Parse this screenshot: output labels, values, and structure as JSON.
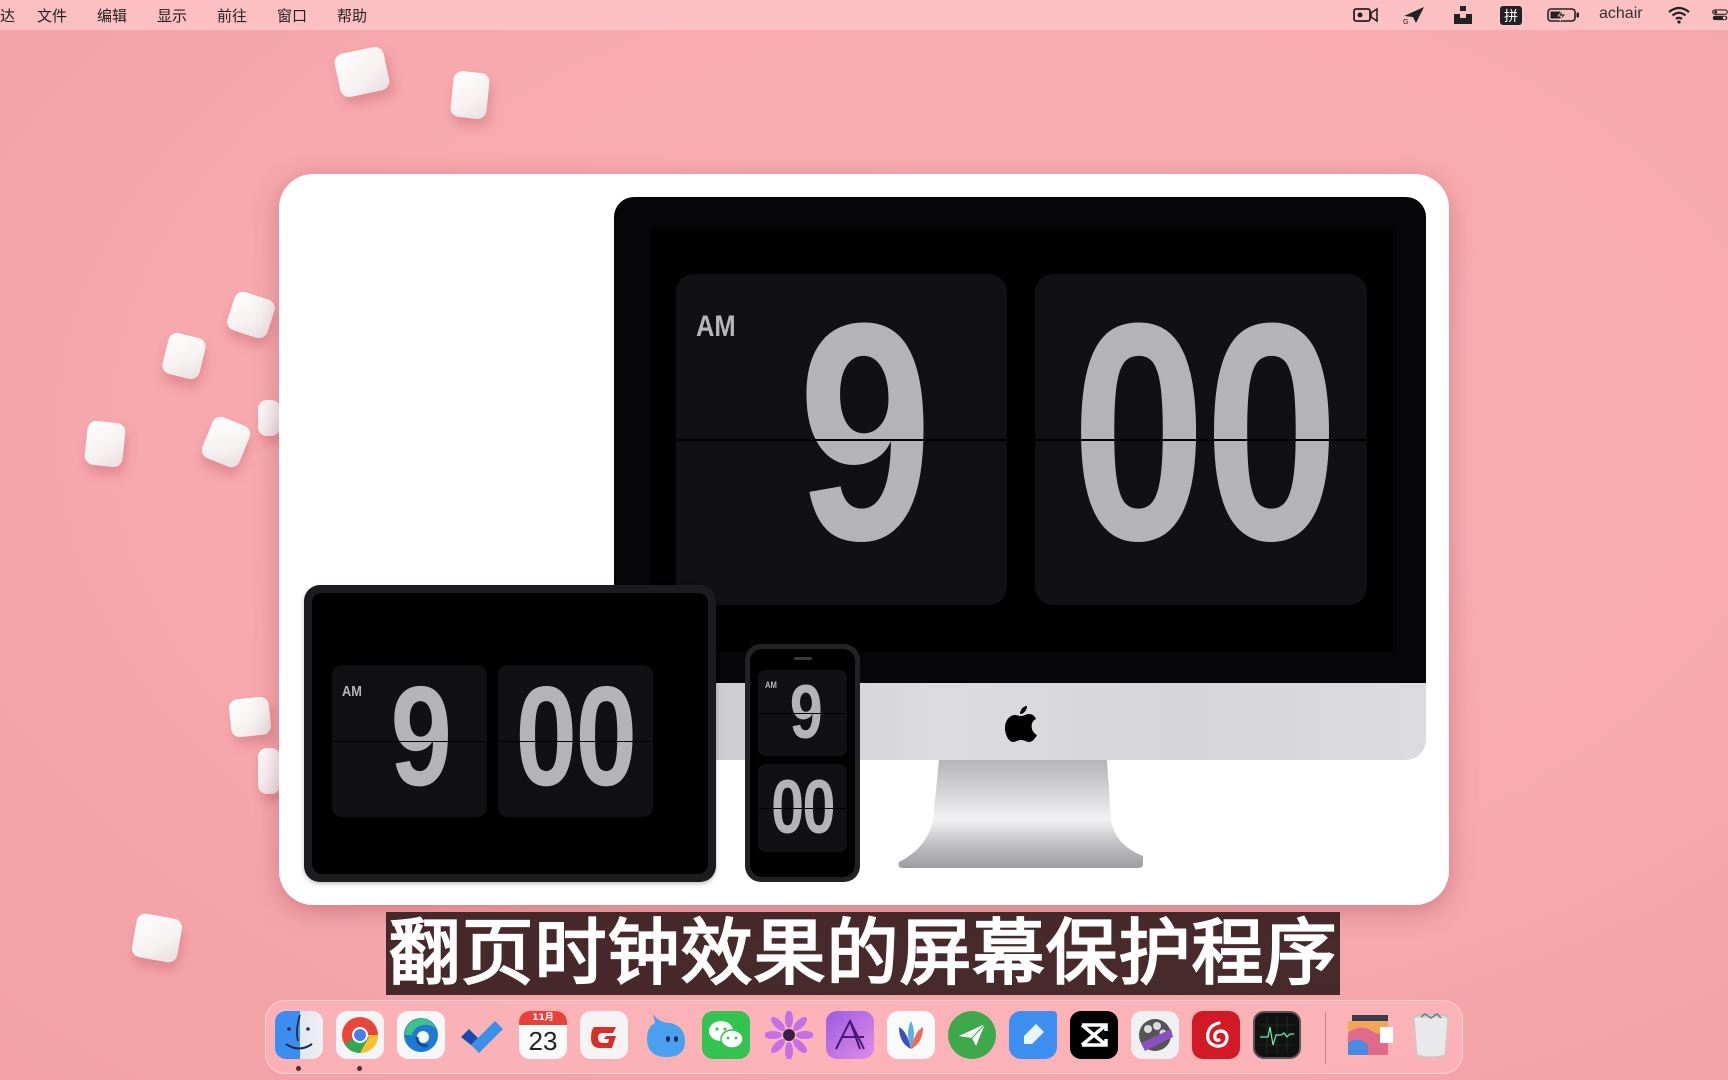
{
  "menubar": {
    "app_partial": "达",
    "items": [
      "文件",
      "编辑",
      "显示",
      "前往",
      "窗口",
      "帮助"
    ],
    "status": {
      "input_method": "拼",
      "user": "achair"
    },
    "status_icons": [
      "screen-record-icon",
      "send-icon",
      "box-icon",
      "input-method-icon",
      "battery-charging-icon",
      "wifi-icon",
      "control-center-icon"
    ]
  },
  "showcase": {
    "imac": {
      "period": "AM",
      "hour": "9",
      "minute": "00"
    },
    "ipad": {
      "period": "AM",
      "hour": "9",
      "minute": "00"
    },
    "iphone": {
      "period": "AM",
      "hour": "9",
      "minute": "00"
    }
  },
  "caption": "翻页时钟效果的屏幕保护程序",
  "dock": {
    "calendar": {
      "month": "11月",
      "day": "23"
    },
    "apps": [
      {
        "name": "Finder",
        "icon": "finder-icon",
        "running": true
      },
      {
        "name": "Google Chrome",
        "icon": "chrome-icon",
        "running": true
      },
      {
        "name": "Microsoft Edge",
        "icon": "edge-icon",
        "running": false
      },
      {
        "name": "Microsoft To Do",
        "icon": "todo-check-icon",
        "running": false
      },
      {
        "name": "Calendar",
        "icon": "calendar-icon",
        "running": false
      },
      {
        "name": "Foxit",
        "icon": "foxit-g-icon",
        "running": false
      },
      {
        "name": "Chat bubble app",
        "icon": "blue-droplet-icon",
        "running": false
      },
      {
        "name": "WeChat",
        "icon": "wechat-icon",
        "running": false
      },
      {
        "name": "Flower app",
        "icon": "purple-flower-icon",
        "running": false
      },
      {
        "name": "Affinity Photo",
        "icon": "affinity-photo-icon",
        "running": false
      },
      {
        "name": "MindNode",
        "icon": "mindnode-leaf-icon",
        "running": false
      },
      {
        "name": "Paper plane app",
        "icon": "paper-plane-icon",
        "running": false
      },
      {
        "name": "Pen app",
        "icon": "pen-icon",
        "running": false
      },
      {
        "name": "CapCut",
        "icon": "capcut-icon",
        "running": false
      },
      {
        "name": "Final Cut Pro",
        "icon": "final-cut-icon",
        "running": false
      },
      {
        "name": "NetEase Music",
        "icon": "netease-music-icon",
        "running": false
      },
      {
        "name": "Activity Monitor",
        "icon": "activity-monitor-icon",
        "running": false
      },
      {
        "name": "Image gallery",
        "icon": "gallery-stack-icon",
        "running": false
      },
      {
        "name": "Trash",
        "icon": "trash-icon",
        "running": false
      }
    ]
  }
}
